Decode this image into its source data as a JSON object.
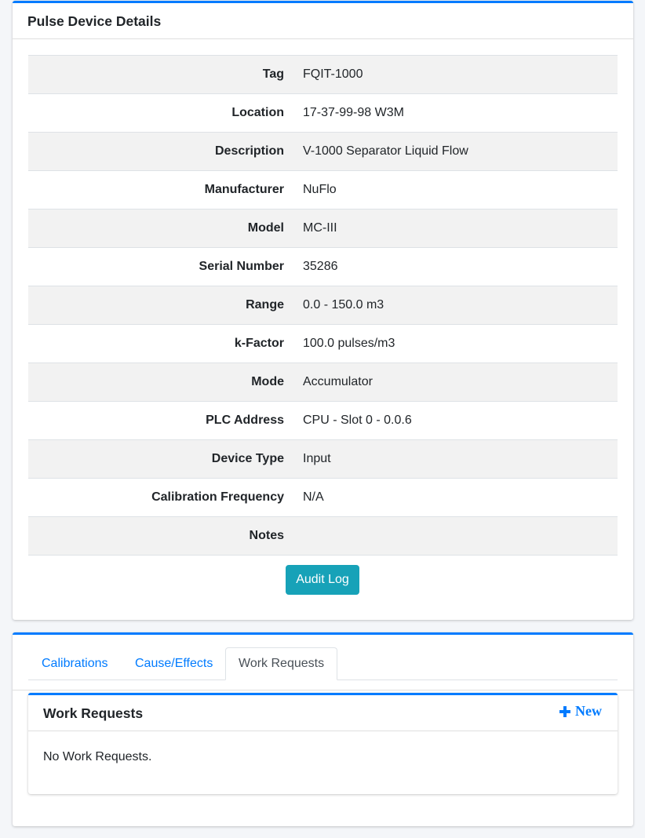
{
  "details": {
    "title": "Pulse Device Details",
    "rows": [
      {
        "label": "Tag",
        "value": "FQIT-1000"
      },
      {
        "label": "Location",
        "value": "17-37-99-98 W3M"
      },
      {
        "label": "Description",
        "value": "V-1000 Separator Liquid Flow"
      },
      {
        "label": "Manufacturer",
        "value": "NuFlo"
      },
      {
        "label": "Model",
        "value": "MC-III"
      },
      {
        "label": "Serial Number",
        "value": "35286"
      },
      {
        "label": "Range",
        "value": "0.0 - 150.0 m3"
      },
      {
        "label": "k-Factor",
        "value": "100.0 pulses/m3"
      },
      {
        "label": "Mode",
        "value": "Accumulator"
      },
      {
        "label": "PLC Address",
        "value": "CPU - Slot 0 - 0.0.6"
      },
      {
        "label": "Device Type",
        "value": "Input"
      },
      {
        "label": "Calibration Frequency",
        "value": "N/A"
      },
      {
        "label": "Notes",
        "value": ""
      }
    ],
    "audit_log_label": "Audit Log"
  },
  "tabs": {
    "items": [
      {
        "label": "Calibrations",
        "active": false
      },
      {
        "label": "Cause/Effects",
        "active": false
      },
      {
        "label": "Work Requests",
        "active": true
      }
    ]
  },
  "work_requests": {
    "title": "Work Requests",
    "new_label": "New",
    "empty_message": "No Work Requests."
  },
  "icons": {
    "new": "plus-icon"
  },
  "colors": {
    "primary": "#007bff",
    "info": "#17a2b8",
    "stripe": "#f2f2f2"
  }
}
